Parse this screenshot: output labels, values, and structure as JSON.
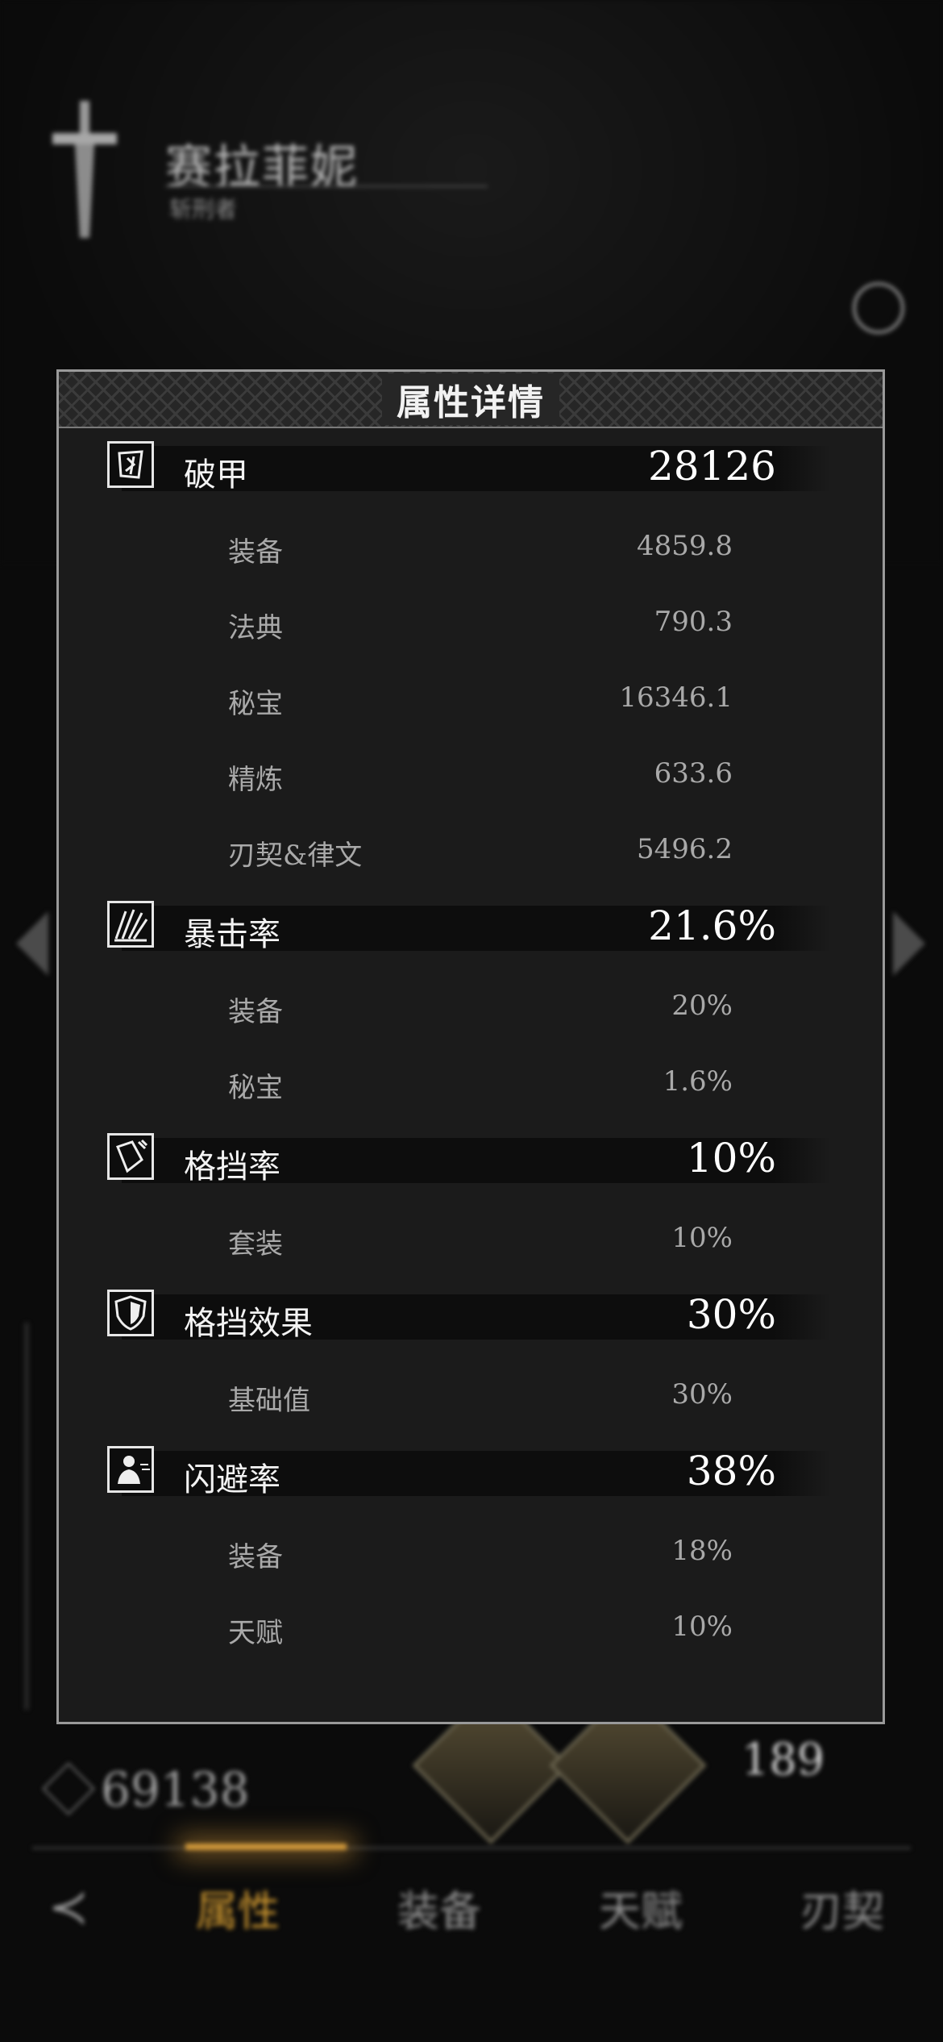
{
  "background": {
    "character_name": "赛拉菲妮",
    "character_title": "斩刑者",
    "power_value": "69138",
    "level": "189",
    "tabs": [
      {
        "label": "属性",
        "active": true
      },
      {
        "label": "装备",
        "active": false
      },
      {
        "label": "天赋",
        "active": false
      },
      {
        "label": "刃契",
        "active": false
      }
    ]
  },
  "panel": {
    "title": "属性详情",
    "stats": [
      {
        "icon": "armor-break-icon",
        "name": "破甲",
        "value": "28126",
        "details": [
          {
            "label": "装备",
            "value": "4859.8"
          },
          {
            "label": "法典",
            "value": "790.3"
          },
          {
            "label": "秘宝",
            "value": "16346.1"
          },
          {
            "label": "精炼",
            "value": "633.6"
          },
          {
            "label": "刃契&律文",
            "value": "5496.2"
          }
        ]
      },
      {
        "icon": "crit-rate-icon",
        "name": "暴击率",
        "value": "21.6%",
        "details": [
          {
            "label": "装备",
            "value": "20%"
          },
          {
            "label": "秘宝",
            "value": "1.6%"
          }
        ]
      },
      {
        "icon": "block-rate-icon",
        "name": "格挡率",
        "value": "10%",
        "details": [
          {
            "label": "套装",
            "value": "10%"
          }
        ]
      },
      {
        "icon": "block-effect-icon",
        "name": "格挡效果",
        "value": "30%",
        "details": [
          {
            "label": "基础值",
            "value": "30%"
          }
        ]
      },
      {
        "icon": "dodge-rate-icon",
        "name": "闪避率",
        "value": "38%",
        "details": [
          {
            "label": "装备",
            "value": "18%"
          },
          {
            "label": "天赋",
            "value": "10%"
          }
        ]
      }
    ]
  },
  "colors": {
    "panel_bg": "#1b1b1b",
    "stat_bar_bg": "#0d0d0d",
    "accent_tab": "#c9942f"
  }
}
